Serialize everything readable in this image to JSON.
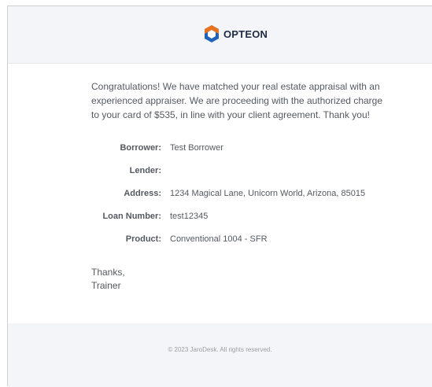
{
  "brand": {
    "name": "OPTEON",
    "mark_colors": {
      "orange": "#e9721e",
      "blue": "#1e63b8"
    },
    "logo_icon": "opteon-hexagon-logo-icon"
  },
  "message": {
    "intro": "Congratulations! We have matched your real estate appraisal with an\nexperienced appraiser. We are proceeding with the authorized charge\nto your card of $535, in line with your client agreement. Thank you!"
  },
  "details": [
    {
      "label": "Borrower:",
      "value": "Test Borrower"
    },
    {
      "label": "Lender:",
      "value": ""
    },
    {
      "label": "Address:",
      "value": "1234 Magical Lane, Unicorn World, Arizona, 85015"
    },
    {
      "label": "Loan Number:",
      "value": "test12345"
    },
    {
      "label": "Product:",
      "value": "Conventional 1004 - SFR"
    }
  ],
  "signoff": {
    "line1": "Thanks,",
    "line2": "Trainer"
  },
  "footer": {
    "copyright": "© 2023 JaroDesk. All rights reserved."
  }
}
